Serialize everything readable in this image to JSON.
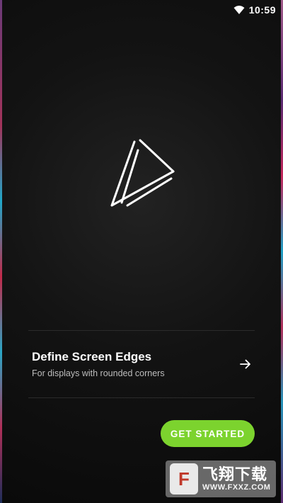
{
  "status_bar": {
    "time": "10:59",
    "wifi_icon": "wifi-icon"
  },
  "logo": {
    "icon": "triangle-play-logo-icon"
  },
  "edges_item": {
    "title": "Define Screen Edges",
    "subtitle": "For displays with rounded corners",
    "arrow_icon": "arrow-right-icon"
  },
  "get_started": {
    "label": "GET STARTED"
  },
  "watermark": {
    "badge": "F",
    "chinese": "飞翔下载",
    "url": "WWW.FXXZ.COM"
  },
  "colors": {
    "accent": "#7cd32e",
    "background": "#131313",
    "text_primary": "#ffffff",
    "text_secondary": "#bdbdbd"
  }
}
